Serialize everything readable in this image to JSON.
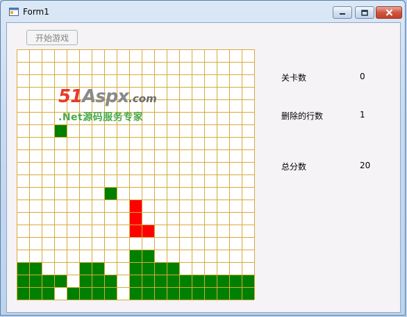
{
  "window": {
    "title": "Form1",
    "icons": {
      "app": "app-window-icon",
      "minimize": "minimize-icon",
      "maximize": "maximize-icon",
      "close": "close-icon"
    }
  },
  "toolbar": {
    "start_label": "开始游戏"
  },
  "stats": {
    "level_label": "关卡数",
    "level_value": "0",
    "lines_label": "删除的行数",
    "lines_value": "1",
    "score_label": "总分数",
    "score_value": "20"
  },
  "watermark": {
    "brand_51": "51",
    "brand_aspx": "Aspx",
    "brand_com": ".com",
    "subtitle": ".Net源码服务专家"
  },
  "board": {
    "columns": 19,
    "rows": 20,
    "colors": {
      "background": "#ffffff",
      "grid": "#d4aa3c",
      "settled": "#008000",
      "active": "#ff0000"
    },
    "settled_cells": [
      [
        3,
        6
      ],
      [
        7,
        11
      ],
      [
        9,
        16
      ],
      [
        10,
        16
      ],
      [
        9,
        17
      ],
      [
        10,
        17
      ],
      [
        11,
        17
      ],
      [
        12,
        17
      ],
      [
        11,
        18
      ],
      [
        12,
        18
      ],
      [
        13,
        18
      ],
      [
        14,
        18
      ],
      [
        15,
        18
      ],
      [
        16,
        18
      ],
      [
        17,
        18
      ],
      [
        18,
        18
      ],
      [
        16,
        19
      ],
      [
        17,
        19
      ],
      [
        18,
        19
      ],
      [
        10,
        19
      ],
      [
        11,
        19
      ]
    ],
    "active_cells": [
      [
        9,
        12
      ],
      [
        9,
        13
      ],
      [
        9,
        14
      ],
      [
        10,
        14
      ]
    ]
  }
}
